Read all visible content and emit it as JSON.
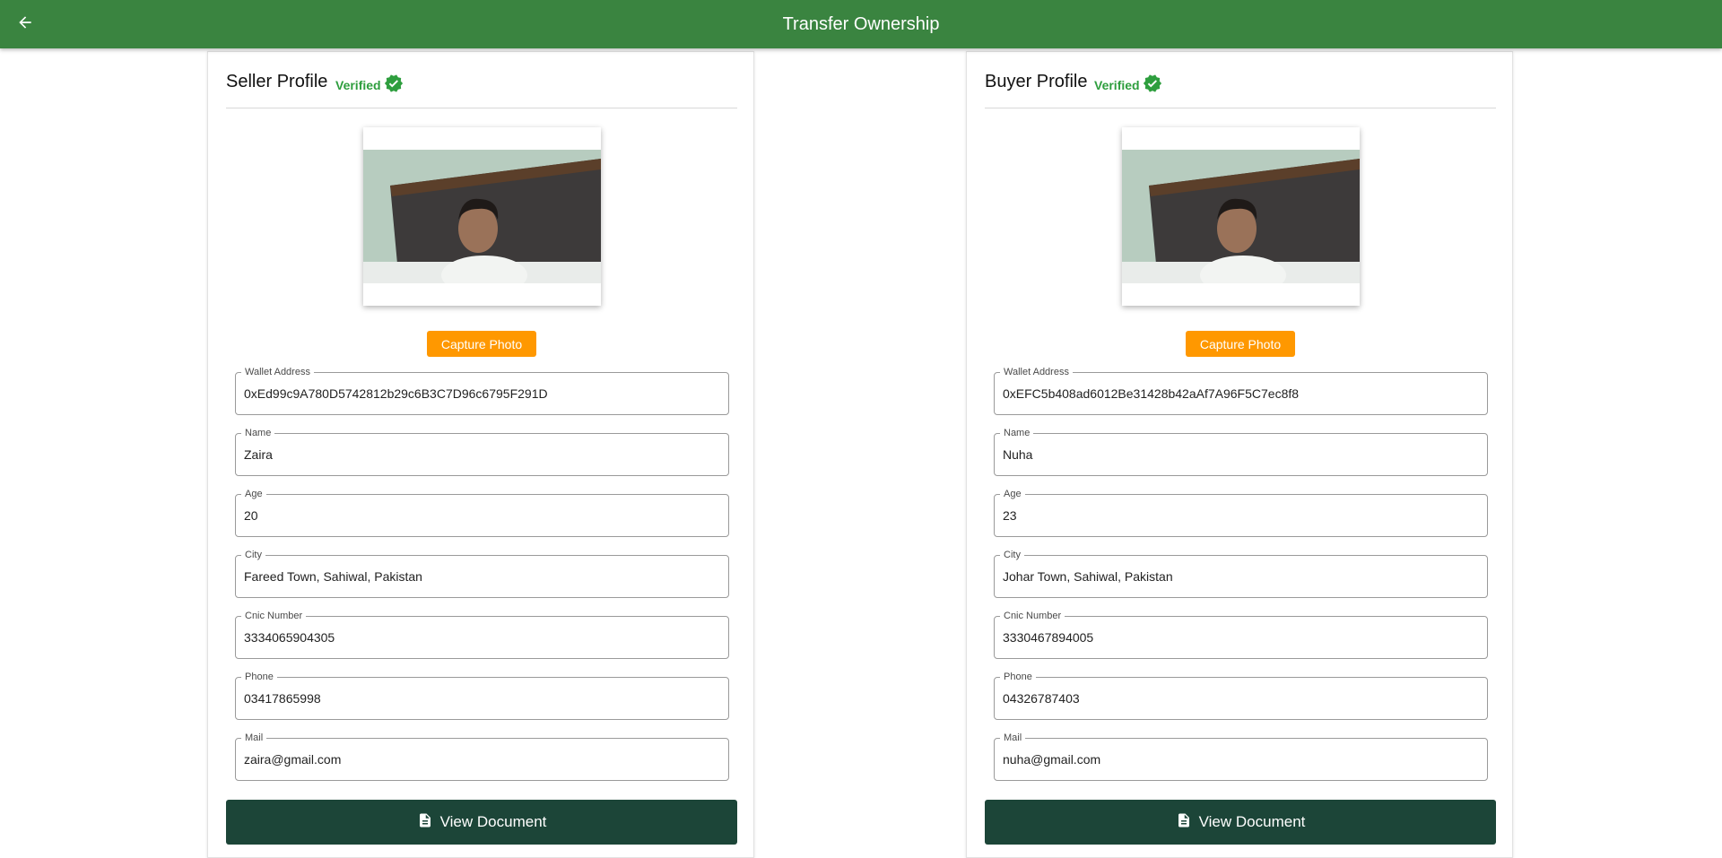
{
  "appbar": {
    "title": "Transfer Ownership",
    "back_icon": "arrow-left-icon",
    "color": "#3a8440"
  },
  "colors": {
    "verified": "#2e9e3e",
    "capture_button": "#ff9800",
    "view_document_button": "#1c4538"
  },
  "seller": {
    "title": "Seller Profile",
    "verified": "Verified",
    "capture_label": "Capture Photo",
    "view_doc_label": "View Document",
    "fields": [
      {
        "label": "Wallet Address",
        "value": "0xEd99c9A780D5742812b29c6B3C7D96c6795F291D"
      },
      {
        "label": "Name",
        "value": "Zaira"
      },
      {
        "label": "Age",
        "value": "20"
      },
      {
        "label": "City",
        "value": "Fareed Town, Sahiwal, Pakistan"
      },
      {
        "label": "Cnic Number",
        "value": "3334065904305"
      },
      {
        "label": "Phone",
        "value": "03417865998"
      },
      {
        "label": "Mail",
        "value": "zaira@gmail.com"
      }
    ]
  },
  "buyer": {
    "title": "Buyer Profile",
    "verified": "Verified",
    "capture_label": "Capture Photo",
    "view_doc_label": "View Document",
    "fields": [
      {
        "label": "Wallet Address",
        "value": "0xEFC5b408ad6012Be31428b42aAf7A96F5C7ec8f8"
      },
      {
        "label": "Name",
        "value": "Nuha"
      },
      {
        "label": "Age",
        "value": "23"
      },
      {
        "label": "City",
        "value": "Johar Town, Sahiwal, Pakistan"
      },
      {
        "label": "Cnic Number",
        "value": "3330467894005"
      },
      {
        "label": "Phone",
        "value": "04326787403"
      },
      {
        "label": "Mail",
        "value": "nuha@gmail.com"
      }
    ]
  }
}
